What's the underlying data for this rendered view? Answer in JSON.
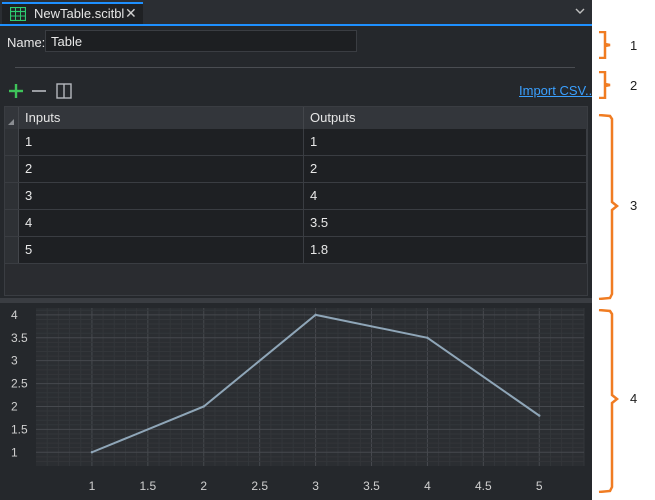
{
  "tab": {
    "title": "NewTable.scitbl",
    "icon": "table-icon",
    "close_icon": "close-icon"
  },
  "name_field": {
    "label": "Name:",
    "value": "Table"
  },
  "toolbar": {
    "add_icon": "plus-icon",
    "remove_icon": "minus-icon",
    "columns_icon": "split-columns-icon",
    "import_label": "Import CSV..."
  },
  "table": {
    "columns": [
      "Inputs",
      "Outputs"
    ],
    "rows": [
      [
        "1",
        "1"
      ],
      [
        "2",
        "2"
      ],
      [
        "3",
        "4"
      ],
      [
        "4",
        "3.5"
      ],
      [
        "5",
        "1.8"
      ]
    ]
  },
  "chart_data": {
    "type": "line",
    "x": [
      1,
      2,
      3,
      4,
      5
    ],
    "y": [
      1,
      2,
      4,
      3.5,
      1.8
    ],
    "xlim": [
      0.5,
      5.4
    ],
    "ylim": [
      0.7,
      4.15
    ],
    "xticks": [
      "1",
      "1.5",
      "2",
      "2.5",
      "3",
      "3.5",
      "4",
      "4.5",
      "5"
    ],
    "yticks": [
      "1",
      "1.5",
      "2",
      "2.5",
      "3",
      "3.5",
      "4"
    ],
    "grid": true,
    "line_color": "#8fa6b8",
    "title": "",
    "xlabel": "",
    "ylabel": ""
  },
  "annotations": [
    "1",
    "2",
    "3",
    "4"
  ],
  "colors": {
    "accent": "#1e90ff",
    "link": "#3aa0ff",
    "callout": "#f07c22",
    "tab_icon": "#2ecc71",
    "add_icon": "#3ec45a"
  }
}
